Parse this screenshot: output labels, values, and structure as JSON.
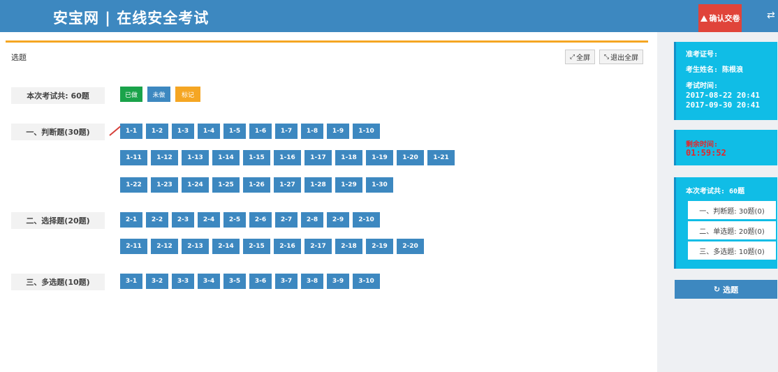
{
  "header": {
    "title": "安宝网 | 在线安全考试",
    "submit_label": "确认交卷",
    "submit_icon": "warning-icon",
    "swap_icon": "swap-icon"
  },
  "colors": {
    "header_bg": "#3d88c0",
    "submit_bg": "#e0443a",
    "done": "#1aa34a",
    "undone": "#3d88c0",
    "marked": "#f5a623",
    "card_bg": "#10bde6",
    "countdown": "#e3262a"
  },
  "main": {
    "section_title": "选题",
    "fullscreen_label": "全屏",
    "exit_fullscreen_label": "退出全屏",
    "total_label": "本次考试共: 60题",
    "legend": {
      "done": "已做",
      "undone": "未做",
      "marked": "标记"
    },
    "groups": [
      {
        "label": "一、判断题(30题)",
        "rows": [
          [
            "1-1",
            "1-2",
            "1-3",
            "1-4",
            "1-5",
            "1-6",
            "1-7",
            "1-8",
            "1-9",
            "1-10"
          ],
          [
            "1-11",
            "1-12",
            "1-13",
            "1-14",
            "1-15",
            "1-16",
            "1-17",
            "1-18",
            "1-19",
            "1-20",
            "1-21"
          ],
          [
            "1-22",
            "1-23",
            "1-24",
            "1-25",
            "1-26",
            "1-27",
            "1-28",
            "1-29",
            "1-30"
          ]
        ]
      },
      {
        "label": "二、选择题(20题)",
        "rows": [
          [
            "2-1",
            "2-2",
            "2-3",
            "2-4",
            "2-5",
            "2-6",
            "2-7",
            "2-8",
            "2-9",
            "2-10"
          ],
          [
            "2-11",
            "2-12",
            "2-13",
            "2-14",
            "2-15",
            "2-16",
            "2-17",
            "2-18",
            "2-19",
            "2-20"
          ]
        ]
      },
      {
        "label": "三、多选题(10题)",
        "rows": [
          [
            "3-1",
            "3-2",
            "3-3",
            "3-4",
            "3-5",
            "3-6",
            "3-7",
            "3-8",
            "3-9",
            "3-10"
          ]
        ]
      }
    ]
  },
  "sidebar": {
    "ticket_label": "准考证号:",
    "name_label": "考生姓名: 陈根浪",
    "time_label": "考试时间:",
    "start_time": "2017-08-22 20:41",
    "end_time": "2017-09-30 20:41",
    "remaining_label": "剩余时间:",
    "remaining_value": "01:59:52",
    "summary_title": "本次考试共: 60题",
    "summary_items": [
      "一、判断题: 30题(0)",
      "二、单选题: 20题(0)",
      "三、多选题: 10题(0)"
    ],
    "nav_label": "选题"
  }
}
